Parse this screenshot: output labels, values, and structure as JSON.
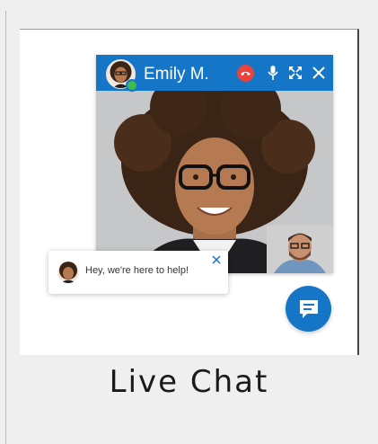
{
  "call": {
    "name": "Emily M.",
    "status": "online",
    "controls": [
      "hang-up-icon",
      "microphone-icon",
      "fullscreen-icon",
      "close-icon"
    ]
  },
  "chat": {
    "message": "Hey, we're here to help!"
  },
  "caption": "Live Chat",
  "colors": {
    "brand": "#1576c8",
    "hangup": "#e8433c",
    "online": "#3ebd4f"
  }
}
